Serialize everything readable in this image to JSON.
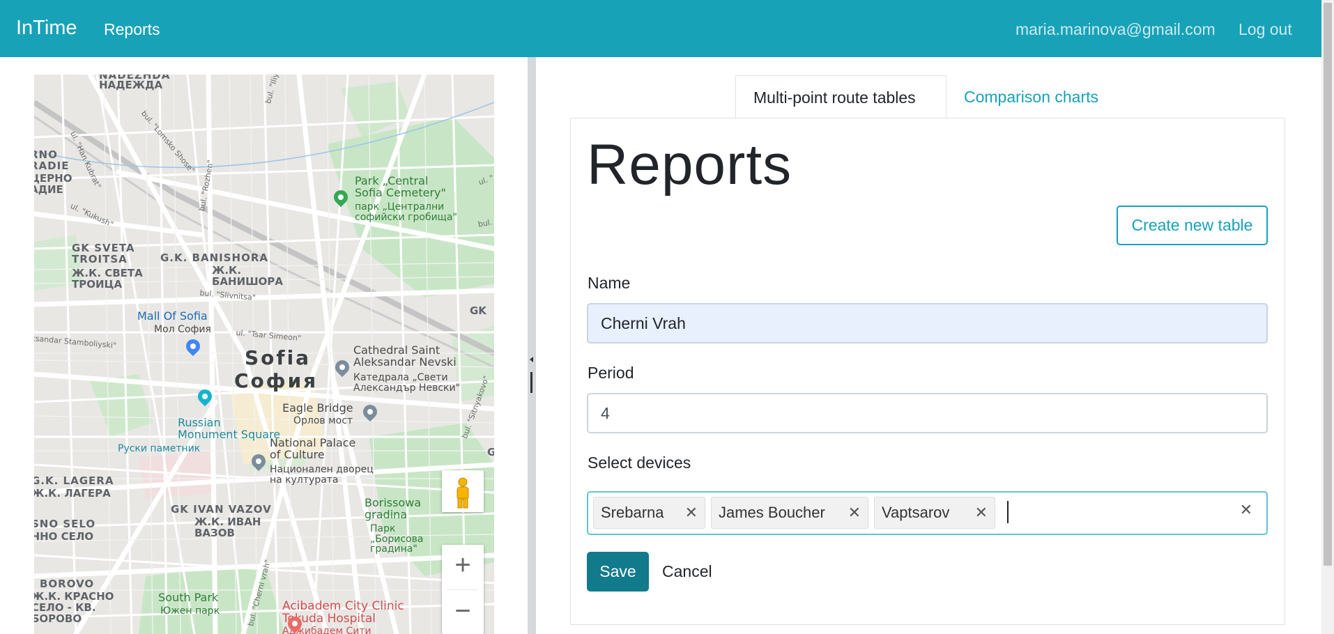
{
  "navbar": {
    "brand": "InTime",
    "reports_link": "Reports",
    "user_email": "maria.marinova@gmail.com",
    "logout": "Log out",
    "color": "#17a2b8"
  },
  "map": {
    "city": "Sofia",
    "city_bg": "София",
    "labels": {
      "nadezhda": "NADEZHDA",
      "nadezhda_bg": "НАДЕЖДА",
      "orno": "RNO\nRADIE",
      "orno_bg": "ЦЕРНО\nАДИЕ",
      "sveta_troitsa": "GK SVETA\nTROITSA",
      "sveta_troitsa_bg": "Ж.К. СВЕТА\nТРОИЦА",
      "banishora": "G.K. BANISHORA",
      "banishora_bg": "Ж.К.\nБАНИШОРА",
      "park": "Park „Central\nSofia Cemetery\"",
      "park_bg": "парк „Централни\nсофийски гробища\"",
      "mall": "Mall Of Sofia",
      "mall_bg": "Мол София",
      "cathedral": "Cathedral Saint\nAleksandar Nevski",
      "cathedral_bg": "Катедрала „Свети\nАлександър Невски\"",
      "eagle": "Eagle Bridge",
      "eagle_bg": "Орлов мост",
      "russian": "Russian\nMonument Square",
      "russian_bg": "Руски паметник",
      "ndk": "National Palace\nof Culture",
      "ndk_bg": "Национален дворец\nна културата",
      "lagera": "G.K. LAGERA",
      "lagera_bg": "Ж.К. ЛАГЕРА",
      "ivan_vazov": "GK IVAN VAZOV",
      "ivan_vazov_bg": "Ж.К. ИВАН\nВАЗОВ",
      "borisova": "Borissowa\ngradina",
      "borisova_bg": "Парк\n„Борисова\nградина\"",
      "novo_selo": "SNO SELO",
      "novo_selo_bg": "ЧНО СЕЛО",
      "borovo": "BOROVO",
      "borovo_bg": "Ж.К. КРАСНО\nСЕЛО - КВ.\nБОРОВО",
      "south_park": "South Park",
      "south_park_bg": "Южен парк",
      "acibadem": "Acibadem City Clinic\nTokuda Hospital",
      "acibadem_bg": "Аджибадем Сити",
      "gk": "GK",
      "kukush": "ul. \"Kukush\"",
      "rozhen": "bul. \"Rozhen\"",
      "slivnitsa": "bul. \"Slivnitsa\"",
      "tsar_simeon": "ul. \"Tsar Simeon\"",
      "stamboliyski": "ksandar Stamboliyski\"",
      "lomsko": "bul. \"Lomsko Shose\"",
      "han_kubrat": "ul. \"Han Kubrat\"",
      "iliyantsi": "bul. \"Iliyantsi\"",
      "cherni_vrah": "bul. \"Cherni vrah\"",
      "sitnyakovo": "bul. \"Sitnyakovo\"",
      "ul_r": "bul. \"R",
      "ul_u": "ul. \"",
      "g_edge": "G"
    },
    "zoom_in": "+",
    "zoom_out": "−"
  },
  "tabs": [
    {
      "label": "Multi-point route tables",
      "active": true
    },
    {
      "label": "Comparison charts",
      "active": false
    }
  ],
  "page": {
    "title": "Reports",
    "create_button": "Create new table"
  },
  "form": {
    "name_label": "Name",
    "name_value": "Cherni Vrah",
    "period_label": "Period",
    "period_value": "4",
    "devices_label": "Select devices",
    "devices": [
      "Srebarna",
      "James Boucher",
      "Vaptsarov"
    ],
    "chip_remove": "✕",
    "clear_all": "✕",
    "save": "Save",
    "cancel": "Cancel"
  }
}
